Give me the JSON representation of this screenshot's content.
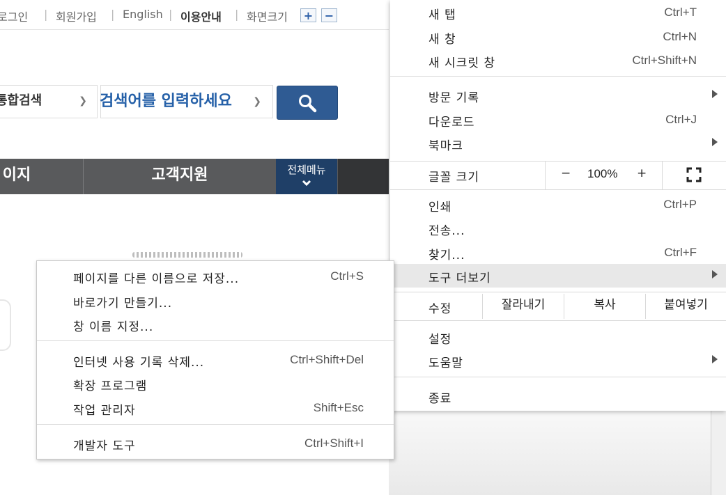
{
  "page": {
    "util_links": [
      "로그인",
      "회원가입",
      "English",
      "이용안내",
      "화면크기"
    ],
    "zoom_in": "+",
    "zoom_out": "−",
    "search": {
      "type_label": "통합검색",
      "placeholder": "검색어를 입력하세요",
      "button_icon": "search-icon"
    },
    "nav": {
      "item_partial": "이지",
      "item_support": "고객지원",
      "all_menu": "전체메뉴"
    }
  },
  "chrome_menu": {
    "new_tab": {
      "label": "새 탭",
      "shortcut": "Ctrl+T"
    },
    "new_window": {
      "label": "새 창",
      "shortcut": "Ctrl+N"
    },
    "incognito": {
      "label": "새 시크릿 창",
      "shortcut": "Ctrl+Shift+N"
    },
    "history": {
      "label": "방문 기록"
    },
    "downloads": {
      "label": "다운로드",
      "shortcut": "Ctrl+J"
    },
    "bookmarks": {
      "label": "북마크"
    },
    "font_size": {
      "label": "글꼴 크기",
      "minus": "−",
      "value": "100%",
      "plus": "+"
    },
    "print": {
      "label": "인쇄",
      "shortcut": "Ctrl+P"
    },
    "cast": {
      "label": "전송..."
    },
    "find": {
      "label": "찾기...",
      "shortcut": "Ctrl+F"
    },
    "more_tools": {
      "label": "도구 더보기"
    },
    "edit": {
      "label": "수정",
      "cut": "잘라내기",
      "copy": "복사",
      "paste": "붙여넣기"
    },
    "settings": {
      "label": "설정"
    },
    "help": {
      "label": "도움말"
    },
    "exit": {
      "label": "종료"
    }
  },
  "submenu": {
    "save_page": {
      "label": "페이지를 다른 이름으로 저장...",
      "shortcut": "Ctrl+S"
    },
    "create_shortcut": {
      "label": "바로가기 만들기..."
    },
    "name_window": {
      "label": "창 이름 지정..."
    },
    "clear_data": {
      "label": "인터넷 사용 기록 삭제...",
      "shortcut": "Ctrl+Shift+Del"
    },
    "extensions": {
      "label": "확장 프로그램"
    },
    "task_manager": {
      "label": "작업 관리자",
      "shortcut": "Shift+Esc"
    },
    "dev_tools": {
      "label": "개발자 도구",
      "shortcut": "Ctrl+Shift+I"
    }
  },
  "colors": {
    "nav_bg": "#595a5c",
    "all_menu_bg": "#1f3f67",
    "search_button": "#2f5b93",
    "placeholder_text": "#2560a8",
    "highlight": "#e8e8e8"
  }
}
